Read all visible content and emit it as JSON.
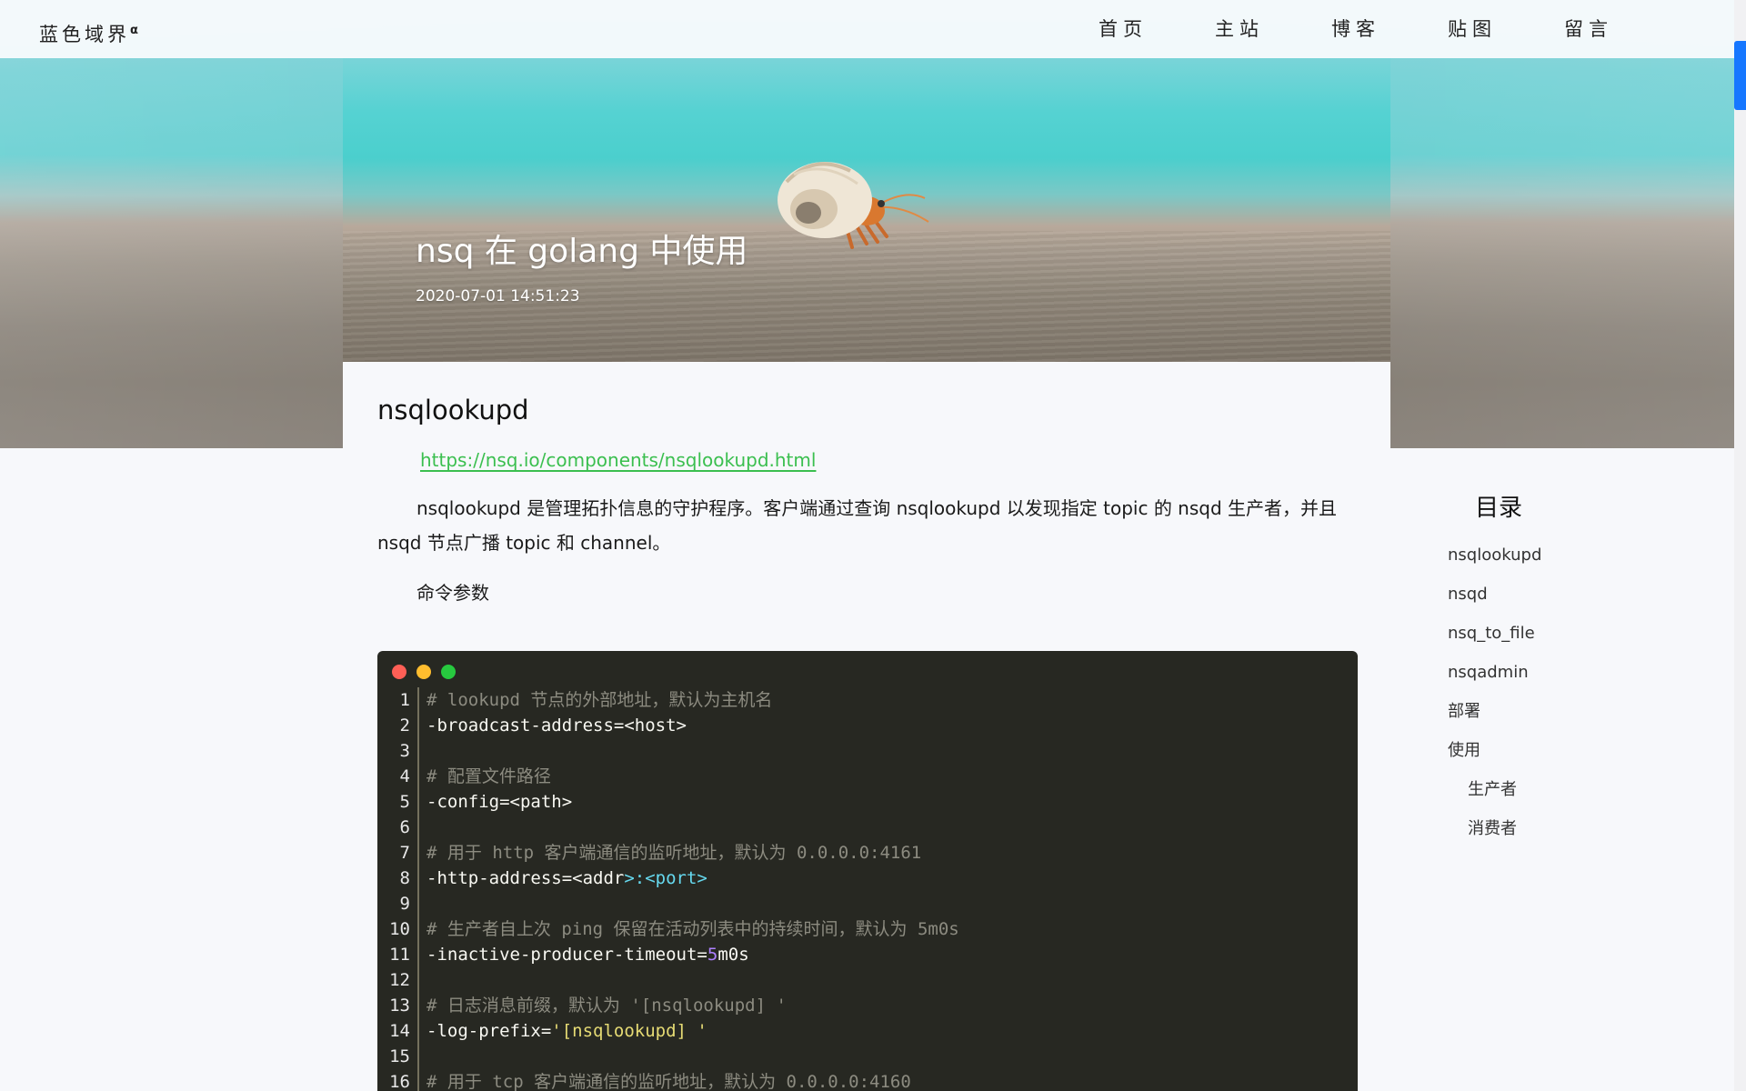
{
  "brand": {
    "name": "蓝色域界",
    "sup": "α"
  },
  "nav": [
    "首页",
    "主站",
    "博客",
    "贴图",
    "留言"
  ],
  "post": {
    "title": "nsq 在 golang 中使用",
    "date": "2020-07-01 14:51:23"
  },
  "section": {
    "heading": "nsqlookupd",
    "link": "https://nsq.io/components/nsqlookupd.html",
    "paragraph": "nsqlookupd 是管理拓扑信息的守护程序。客户端通过查询 nsqlookupd 以发现指定 topic 的 nsqd 生产者，并且 nsqd 节点广播 topic 和 channel。",
    "params_label": "命令参数"
  },
  "code": {
    "dots": [
      "#ff5f56",
      "#ffbd2e",
      "#27c93f"
    ],
    "lines": [
      {
        "n": "1",
        "parts": [
          [
            "comment",
            "# lookupd 节点的外部地址，默认为主机名"
          ]
        ]
      },
      {
        "n": "2",
        "parts": [
          [
            "plain",
            "-broadcast-address=<host>"
          ]
        ]
      },
      {
        "n": "3",
        "parts": []
      },
      {
        "n": "4",
        "parts": [
          [
            "comment",
            "# 配置文件路径"
          ]
        ]
      },
      {
        "n": "5",
        "parts": [
          [
            "plain",
            "-config=<path>"
          ]
        ]
      },
      {
        "n": "6",
        "parts": []
      },
      {
        "n": "7",
        "parts": [
          [
            "comment",
            "# 用于 http 客户端通信的监听地址，默认为 0.0.0.0:4161"
          ]
        ]
      },
      {
        "n": "8",
        "parts": [
          [
            "plain",
            "-http-address=<addr"
          ],
          [
            "tag",
            ">:<port>"
          ]
        ]
      },
      {
        "n": "9",
        "parts": []
      },
      {
        "n": "10",
        "parts": [
          [
            "comment",
            "# 生产者自上次 ping 保留在活动列表中的持续时间，默认为 5m0s"
          ]
        ]
      },
      {
        "n": "11",
        "parts": [
          [
            "plain",
            "-inactive-producer-timeout="
          ],
          [
            "num",
            "5"
          ],
          [
            "plain",
            "m0s"
          ]
        ]
      },
      {
        "n": "12",
        "parts": []
      },
      {
        "n": "13",
        "parts": [
          [
            "comment",
            "# 日志消息前缀，默认为 '[nsqlookupd] '"
          ]
        ]
      },
      {
        "n": "14",
        "parts": [
          [
            "plain",
            "-log-prefix="
          ],
          [
            "str",
            "'[nsqlookupd] '"
          ]
        ]
      },
      {
        "n": "15",
        "parts": []
      },
      {
        "n": "16",
        "parts": [
          [
            "comment",
            "# 用于 tcp 客户端通信的监听地址，默认为 0.0.0.0:4160"
          ]
        ]
      }
    ]
  },
  "toc": {
    "title": "目录",
    "items": [
      {
        "label": "nsqlookupd",
        "sub": false
      },
      {
        "label": "nsqd",
        "sub": false
      },
      {
        "label": "nsq_to_file",
        "sub": false
      },
      {
        "label": "nsqadmin",
        "sub": false
      },
      {
        "label": "部署",
        "sub": false
      },
      {
        "label": "使用",
        "sub": false
      },
      {
        "label": "生产者",
        "sub": true
      },
      {
        "label": "消费者",
        "sub": true
      }
    ]
  }
}
